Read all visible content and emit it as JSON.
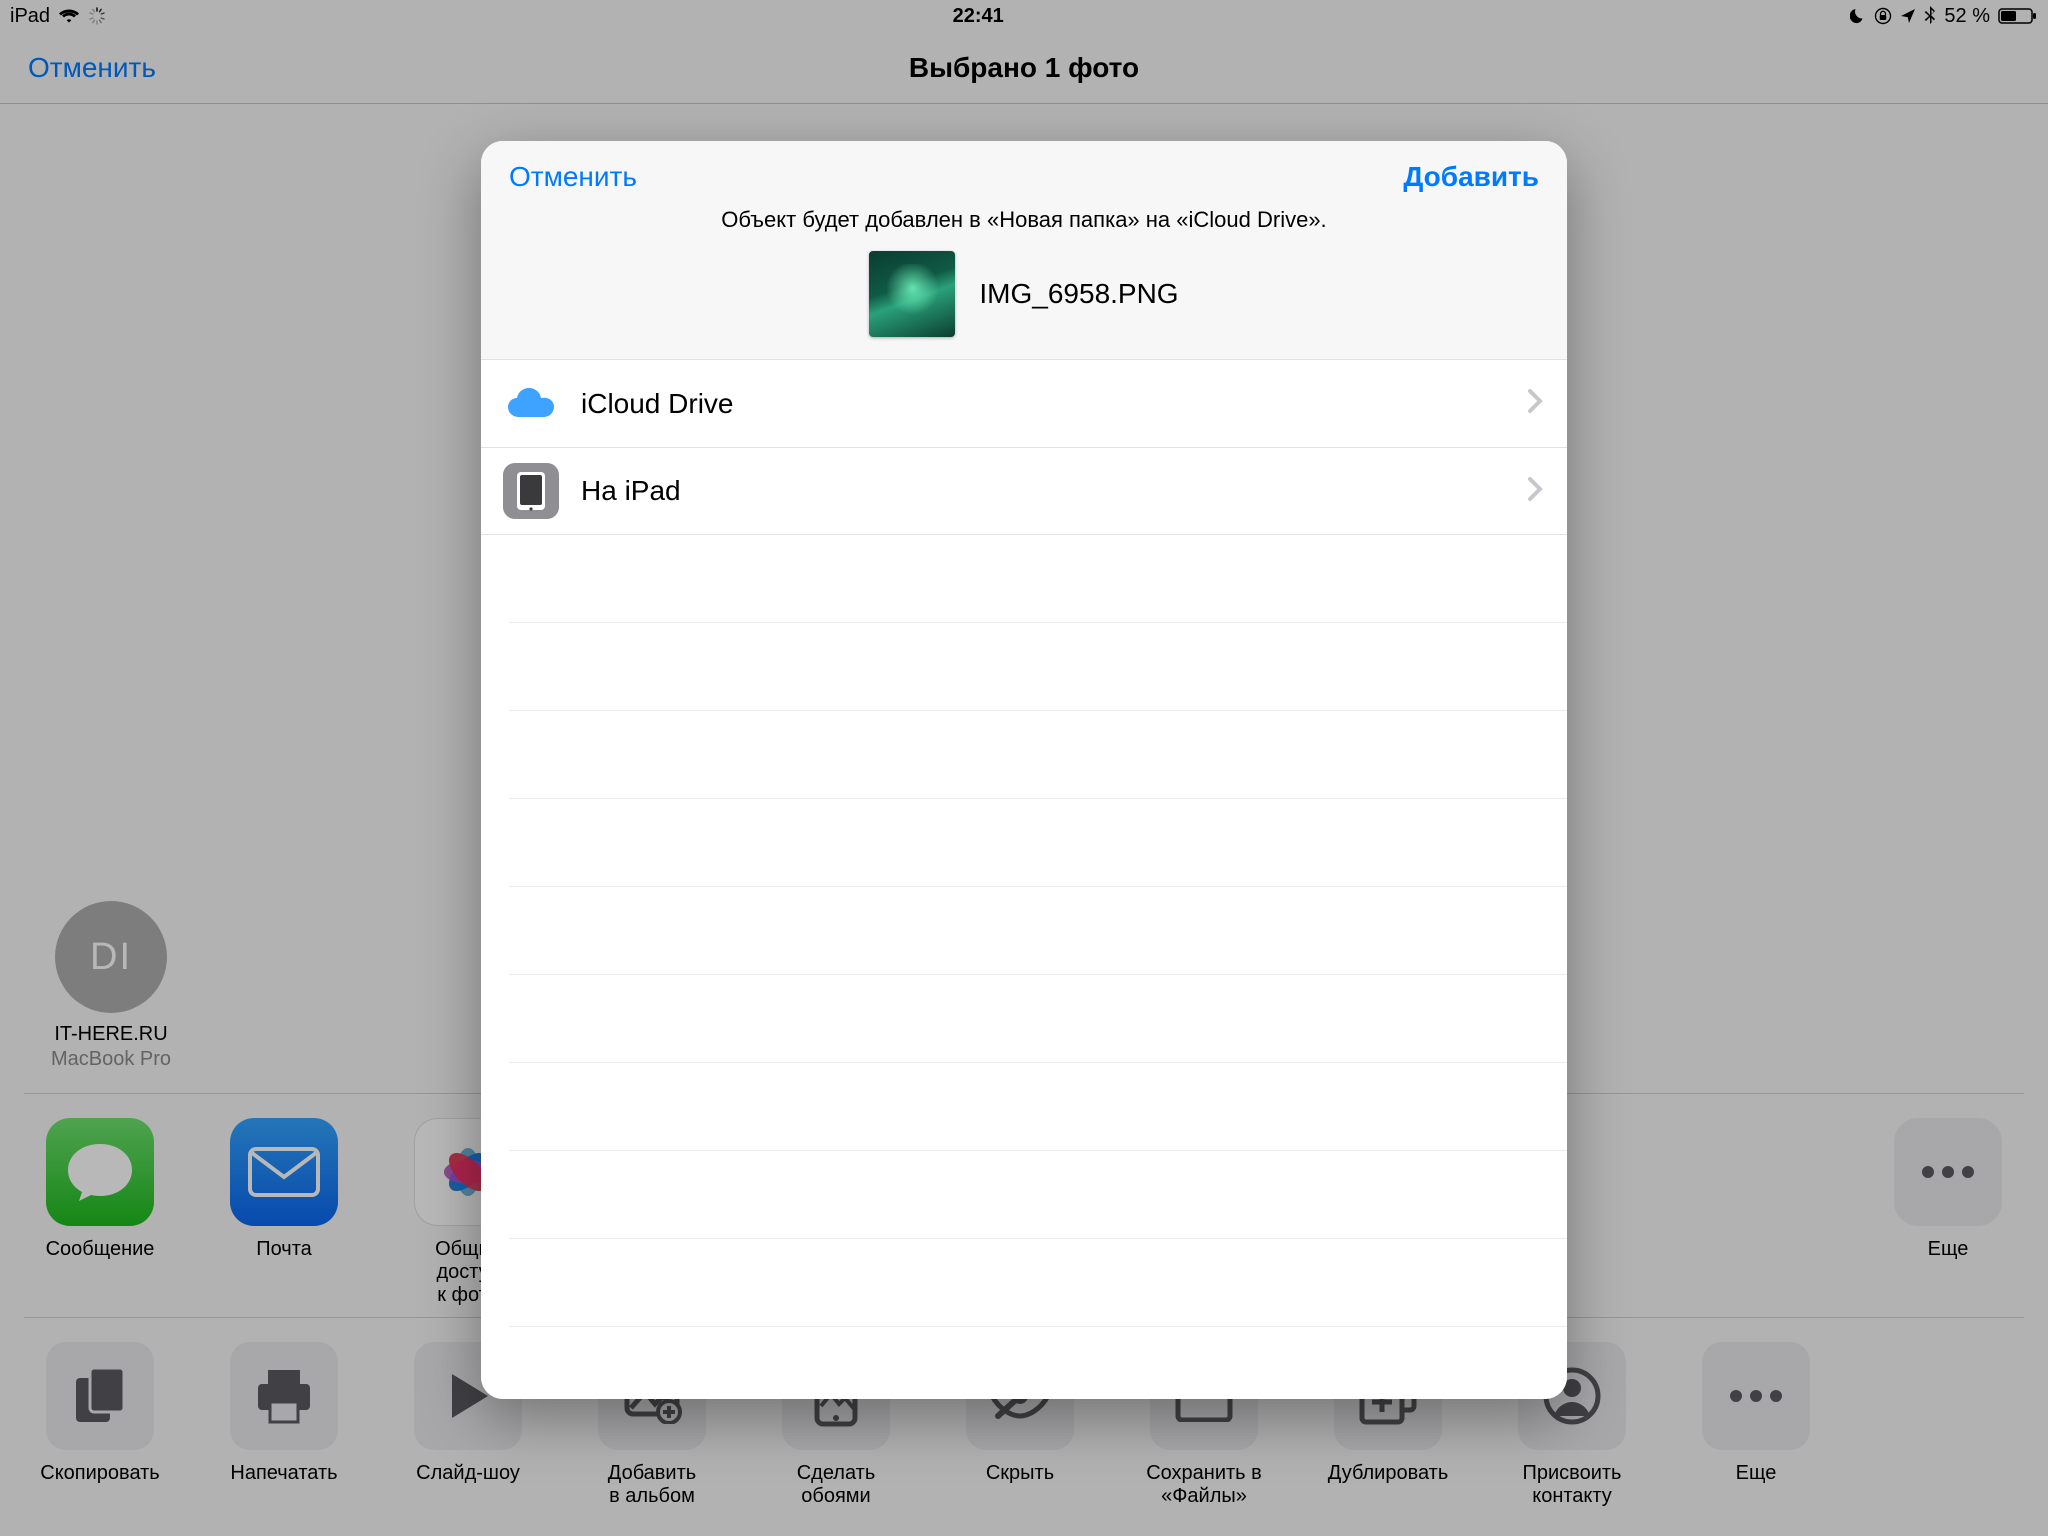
{
  "status": {
    "device": "iPad",
    "time": "22:41",
    "battery_pct": "52 %"
  },
  "nav": {
    "cancel": "Отменить",
    "title": "Выбрано 1 фото"
  },
  "airdrop": {
    "initials": "DI",
    "name": "IT-HERE.RU",
    "sub": "MacBook Pro"
  },
  "apps": {
    "messages": "Сообщение",
    "mail": "Почта",
    "shared": "Общий доступ\nк фото",
    "more": "Еще"
  },
  "actions": {
    "copy": "Скопировать",
    "print": "Напечатать",
    "slideshow": "Слайд-шоу",
    "add_album": "Добавить\nв альбом",
    "wallpaper": "Сделать\nобоями",
    "hide": "Скрыть",
    "save_files": "Сохранить в\n«Файлы»",
    "duplicate": "Дублировать",
    "assign": "Присвоить\nконтакту",
    "more": "Еще"
  },
  "modal": {
    "cancel": "Отменить",
    "add": "Добавить",
    "desc": "Объект будет добавлен в «Новая папка» на «iCloud Drive».",
    "filename": "IMG_6958.PNG",
    "locations": [
      {
        "label": "iCloud Drive"
      },
      {
        "label": "На iPad"
      }
    ]
  }
}
